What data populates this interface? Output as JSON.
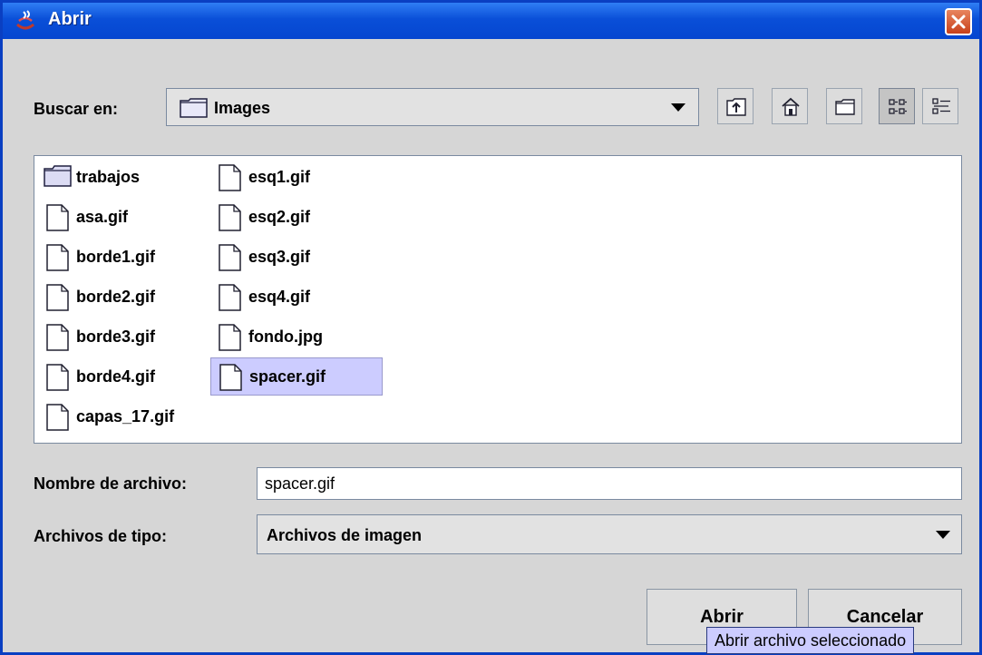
{
  "window": {
    "title": "Abrir"
  },
  "look_in": {
    "label": "Buscar en:",
    "folder": "Images"
  },
  "toolbar": {
    "icons": [
      "up-one-level-icon",
      "home-icon",
      "new-folder-icon",
      "list-view-icon",
      "details-view-icon"
    ]
  },
  "files": {
    "column1": [
      "trabajos",
      "asa.gif",
      "borde1.gif",
      "borde2.gif",
      "borde3.gif",
      "borde4.gif",
      "capas_17.gif"
    ],
    "column2": [
      "esq1.gif",
      "esq2.gif",
      "esq3.gif",
      "esq4.gif",
      "fondo.jpg",
      "spacer.gif"
    ],
    "selected": "spacer.gif"
  },
  "filename": {
    "label": "Nombre de archivo:",
    "value": "spacer.gif"
  },
  "filetype": {
    "label": "Archivos de tipo:",
    "value": "Archivos de imagen"
  },
  "buttons": {
    "open": "Abrir",
    "cancel": "Cancelar"
  },
  "tooltip": {
    "text": "Abrir archivo seleccionado"
  },
  "colors": {
    "title_bar": "#0a4fd8",
    "selection": "#ccccff",
    "close_button": "#d4542a"
  }
}
